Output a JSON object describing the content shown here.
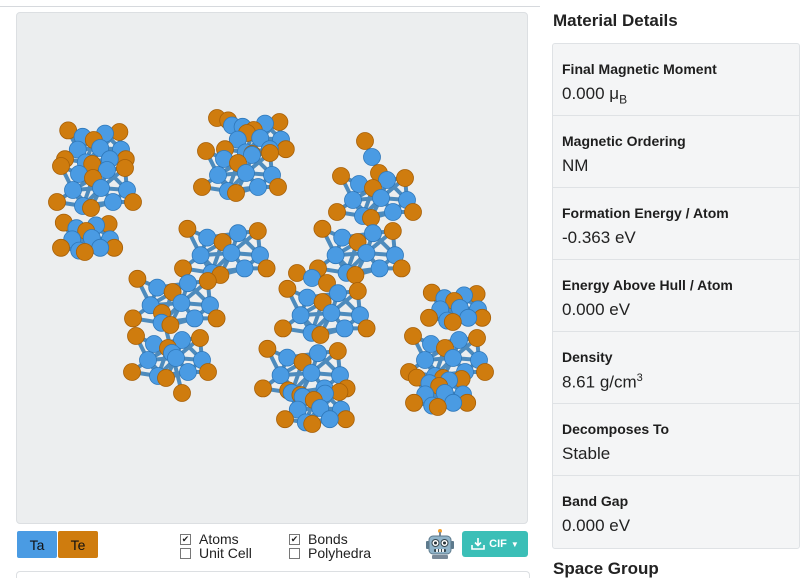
{
  "viewer": {
    "legend": [
      {
        "symbol": "Ta",
        "color": "#4a9be3"
      },
      {
        "symbol": "Te",
        "color": "#cf7c0e"
      }
    ],
    "toggles": {
      "atoms": {
        "label": "Atoms",
        "checked": true
      },
      "unit_cell": {
        "label": "Unit Cell",
        "checked": false
      },
      "bonds": {
        "label": "Bonds",
        "checked": true
      },
      "polyhedra": {
        "label": "Polyhedra",
        "checked": false
      }
    },
    "download": {
      "label": "CIF",
      "icon": "download-icon"
    },
    "assistant": {
      "icon": "robot-icon"
    },
    "bond_color": "#4d8bbd"
  },
  "details": {
    "title": "Material Details",
    "properties": [
      {
        "label": "Final Magnetic Moment",
        "value": "0.000",
        "unit": "μ",
        "unit_sub": "B"
      },
      {
        "label": "Magnetic Ordering",
        "value": "NM"
      },
      {
        "label": "Formation Energy / Atom",
        "value": "-0.363",
        "unit": "eV"
      },
      {
        "label": "Energy Above Hull / Atom",
        "value": "0.000",
        "unit": "eV"
      },
      {
        "label": "Density",
        "value": "8.61",
        "unit": "g/cm",
        "unit_sup": "3"
      },
      {
        "label": "Decomposes To",
        "value": "Stable"
      },
      {
        "label": "Band Gap",
        "value": "0.000",
        "unit": "eV"
      }
    ]
  },
  "space_group": {
    "title": "Space Group"
  }
}
